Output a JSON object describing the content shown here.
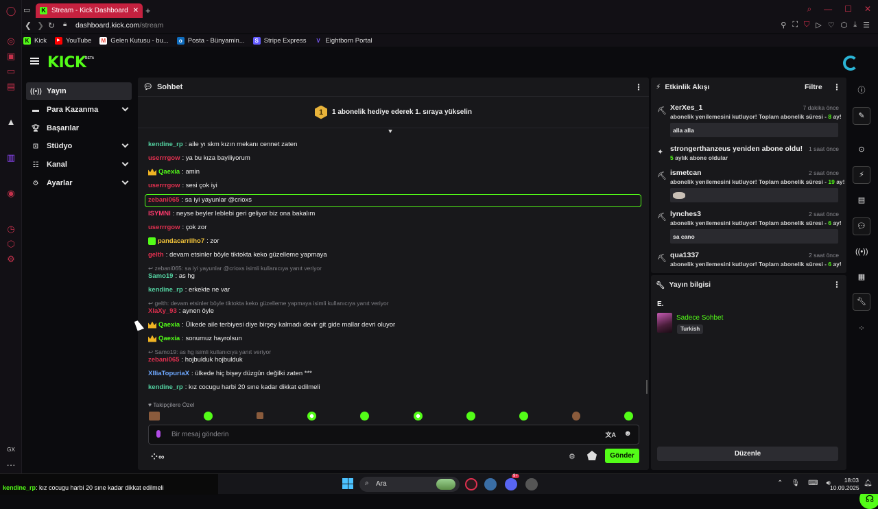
{
  "browser": {
    "tab_title": "Stream - Kick Dashboard",
    "url_domain": "dashboard.kick.com",
    "url_path": "/stream",
    "bookmarks": [
      {
        "label": "Kick",
        "icon": "kick-icon",
        "color": "#53fc18"
      },
      {
        "label": "YouTube",
        "icon": "youtube-icon",
        "color": "#ff0000"
      },
      {
        "label": "Gelen Kutusu - bu...",
        "icon": "gmail-icon",
        "color": "#ea4335"
      },
      {
        "label": "Posta - Bünyamin...",
        "icon": "outlook-icon",
        "color": "#0f6cbd"
      },
      {
        "label": "Stripe Express",
        "icon": "stripe-icon",
        "color": "#635bff"
      },
      {
        "label": "Eightborn Portal",
        "icon": "eightborn-icon",
        "color": "#7c5cff"
      }
    ]
  },
  "brand": {
    "logo": "KICK",
    "beta": "BETA",
    "accent": "#53fc18"
  },
  "sidebar": {
    "items": [
      {
        "label": "Yayın",
        "icon": "broadcast-icon",
        "active": true
      },
      {
        "label": "Para Kazanma",
        "icon": "money-icon",
        "expandable": true
      },
      {
        "label": "Başarılar",
        "icon": "trophy-icon"
      },
      {
        "label": "Stüdyo",
        "icon": "studio-icon",
        "expandable": true
      },
      {
        "label": "Kanal",
        "icon": "channel-icon",
        "expandable": true
      },
      {
        "label": "Ayarlar",
        "icon": "gear-icon",
        "expandable": true
      }
    ]
  },
  "chat": {
    "title": "Sohbet",
    "gift_banner": "1 abonelik hediye ederek 1. sıraya yükselin",
    "gift_rank": "1",
    "messages": [
      {
        "user": "kendine_rp",
        "color": "#53d0a0",
        "text": ": aile yı skm kızın mekanı cennet zaten"
      },
      {
        "user": "userrrgow",
        "color": "#e0304f",
        "text": ": ya bu kıza bayiliyorum"
      },
      {
        "user": "Qaexia",
        "color": "#53fc18",
        "badge": "crown",
        "text": ": amin"
      },
      {
        "user": "userrrgow",
        "color": "#e0304f",
        "text": ": sesi çok iyi"
      },
      {
        "user": "zebani065",
        "color": "#e0304f",
        "text": ": sa iyi yayunlar @crioxs",
        "highlight": true
      },
      {
        "user": "ISYMNI",
        "color": "#ff3b6e",
        "text": ": neyse beyler leblebi geri geliyor biz ona bakalım"
      },
      {
        "user": "userrrgow",
        "color": "#e0304f",
        "text": ": çok zor"
      },
      {
        "user": "pandacarrilho7",
        "color": "#f0c23a",
        "badge": "sub",
        "text": ": zor"
      },
      {
        "user": "gelth",
        "color": "#e0304f",
        "text": ": devam etsinler böyle tiktokta keko güzelleme yapmaya"
      },
      {
        "reply": "zebani065: sa iyi yayunlar @crioxs isimli kullanıcıya yanıt veriyor",
        "user": "Samo19",
        "color": "#53d0a0",
        "text": ": as hg"
      },
      {
        "user": "kendine_rp",
        "color": "#53d0a0",
        "text": ": erkekte ne var"
      },
      {
        "reply": "gelth: devam etsinler böyle tiktokta keko güzelleme yapmaya isimli kullanıcıya yanıt veriyor",
        "user": "XlaXy_93",
        "color": "#e0304f",
        "text": ": aynen öyle"
      },
      {
        "user": "Qaexia",
        "color": "#53fc18",
        "badge": "crown",
        "text": ": Ülkede aile terbiyesi diye birşey kalmadı devir git gide mallar devri oluyor"
      },
      {
        "user": "Qaexia",
        "color": "#53fc18",
        "badge": "crown",
        "text": ": sonumuz hayrolsun"
      },
      {
        "reply": "Samo19: as hg isimli kullanıcıya yanıt veriyor",
        "user": "zebani065",
        "color": "#e0304f",
        "text": ": hojbulduk hojbulduk"
      },
      {
        "user": "XlliaTopuriaX",
        "color": "#6ea8ff",
        "text": ": ülkede hiç bişey düzgün değilki zaten ***"
      },
      {
        "user": "kendine_rp",
        "color": "#53d0a0",
        "text": ": kız cocugu harbi 20 sıne kadar dikkat edilmeli"
      }
    ],
    "follower_only": "Takipçilere Özel",
    "input_placeholder": "Bir mesaj gönderin",
    "send_label": "Gönder"
  },
  "activity": {
    "title": "Etkinlik Akışı",
    "filter_label": "Filtre",
    "events": [
      {
        "name": "XerXes_1",
        "time": "7 dakika önce",
        "desc": "abonelik yenilemesini kutluyor! Toplam abonelik süresi - ",
        "months": "8",
        "suffix": " ay!",
        "message": "alla alla",
        "icon": "resub-icon"
      },
      {
        "name": "strongerthanzeus yeniden abone oldu!",
        "time": "1 saat önce",
        "desc_prefix": "5",
        "desc": " aylık abone oldular",
        "icon": "sparkle-icon"
      },
      {
        "name": "ismetcan",
        "time": "2 saat önce",
        "desc": "abonelik yenilemesini kutluyor! Toplam abonelik süresi - ",
        "months": "19",
        "suffix": " ay!",
        "message_emote": "emote-image",
        "icon": "resub-icon"
      },
      {
        "name": "lynches3",
        "time": "2 saat önce",
        "desc": "abonelik yenilemesini kutluyor! Toplam abonelik süresi - ",
        "months": "6",
        "suffix": " ay!",
        "message": "sa cano",
        "icon": "resub-icon"
      },
      {
        "name": "qua1337",
        "time": "2 saat önce",
        "desc": "abonelik yenilemesini kutluyor! Toplam abonelik süresi - ",
        "months": "6",
        "suffix": " ay!",
        "icon": "resub-icon"
      }
    ]
  },
  "stream_info": {
    "title": "Yayın bilgisi",
    "stream_title": "E.",
    "category": "Sadece Sohbet",
    "language": "Turkish",
    "edit_label": "Düzenle"
  },
  "taskbar": {
    "ticker_user": "kendine_rp",
    "ticker_text": ": kız cocugu harbi 20 sıne kadar dikkat edilmeli",
    "search_placeholder": "Ara",
    "time": "18:03",
    "date": "10.09.2025",
    "discord_badge": "9+"
  }
}
